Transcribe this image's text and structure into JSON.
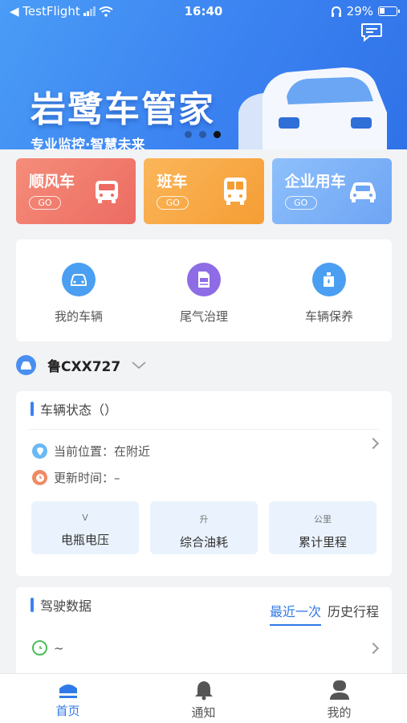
{
  "status_bar": {
    "back_app": "◀ TestFlight",
    "time": "16:40",
    "battery": "29%"
  },
  "banner": {
    "title": "岩鹭车管家",
    "subtitle": "专业监控·智慧未来",
    "active_slide": 3,
    "slide_count": 3
  },
  "quick_actions": [
    {
      "label": "顺风车",
      "go": "GO"
    },
    {
      "label": "班车",
      "go": "GO"
    },
    {
      "label": "企业用车",
      "go": "GO"
    }
  ],
  "services": [
    {
      "label": "我的车辆",
      "icon": "car-icon"
    },
    {
      "label": "尾气治理",
      "icon": "document-icon"
    },
    {
      "label": "车辆保养",
      "icon": "oil-icon"
    }
  ],
  "vehicle": {
    "plate": "鲁CXX727"
  },
  "vehicle_status": {
    "title": "车辆状态（）",
    "location_label": "当前位置：在附近",
    "update_label": "更新时间：–",
    "metrics": [
      {
        "unit": "V",
        "label": "电瓶电压"
      },
      {
        "unit": "升",
        "label": "综合油耗"
      },
      {
        "unit": "公里",
        "label": "累计里程"
      }
    ]
  },
  "driving_data": {
    "title": "驾驶数据",
    "tabs": [
      "最近一次",
      "历史行程"
    ],
    "active_tab": 0,
    "time_range": "~"
  },
  "tab_bar": [
    {
      "label": "首页",
      "active": true
    },
    {
      "label": "通知",
      "active": false
    },
    {
      "label": "我的",
      "active": false
    }
  ],
  "colors": {
    "accent": "#2f7ae8",
    "card_red": "#ec6b62",
    "card_orange": "#f59d34",
    "card_blue": "#6ea4f4"
  }
}
